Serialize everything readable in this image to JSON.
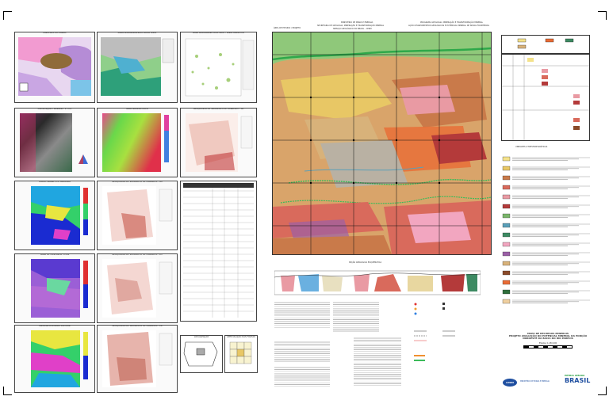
{
  "header": {
    "org_line1": "MINISTÉRIO DE MINAS E ENERGIA",
    "org_line2": "SECRETARIA DE GEOLOGIA, MINERAÇÃO E TRANSFORMAÇÃO MINERAL",
    "org_line3": "SERVIÇO GEOLÓGICO DO BRASIL - CPRM",
    "right_line1": "PROGRAMA GEOLOGIA, MINERAÇÃO E TRANSFORMAÇÃO MINERAL",
    "right_line2": "AÇÃO LEVANTAMENTOS GEOLÓGICOS E POTENCIAL MINERAL DE NOVAS FRONTEIRAS",
    "left_title": "ÁREA DE ESTUDO / PROJETO"
  },
  "panels": {
    "geo_context": "MAPA GEOTECTÔNICO",
    "geophysics": "MAPA AEROGAMAESPECTROMÉTRICO",
    "aeromag": "MAPA AEROMAGNETOMÉTRICO - SINAL ANALÍTICO",
    "ternary": "COMPOSIÇÃO TERNÁRIA - K Th U",
    "gravity": "MAPA GRAVIMÉTRICO",
    "anomaly_mag": "CAMPO MAGNÉTICO ANÔMALO",
    "residual": "MAPA DE CONTAGEM TOTAL",
    "tilt": "PRIMEIRA DERIVADA VERTICAL",
    "geochem_cu": "GEOQUÍMICA DE SEDIMENTO DE CORRENTE - Cu",
    "geochem_au": "GEOQUÍMICA DE SEDIMENTO DE CORRENTE - Au",
    "geochem_zn": "GEOQUÍMICA DE SEDIMENTO DE CORRENTE - Zn",
    "geochem_pb": "GEOQUÍMICA DE SEDIMENTO DE CORRENTE - Pb",
    "geochem_ni": "GEOQUÍMICA DE SEDIMENTO DE CORRENTE - Ni",
    "occurrences": "MAPA DE OCORRÊNCIAS MINERAIS",
    "location": "LOCALIZAÇÃO",
    "articulation": "ARTICULAÇÃO DAS FOLHAS"
  },
  "main_map": {
    "section_title": "SEÇÃO GEOLÓGICA ESQUEMÁTICA",
    "legend_title": "UNIDADES LITOESTRATIGRÁFICAS",
    "coord_labels": [
      "58°00'",
      "57°30'",
      "57°00'",
      "56°30'",
      "56°00'",
      "55°30'"
    ]
  },
  "legend": {
    "units": [
      {
        "color": "#f4e28a"
      },
      {
        "color": "#e8c765"
      },
      {
        "color": "#c97a4a"
      },
      {
        "color": "#d96a5c"
      },
      {
        "color": "#e99aa3"
      },
      {
        "color": "#b43a3a"
      },
      {
        "color": "#7ab56a"
      },
      {
        "color": "#5a9fb8"
      },
      {
        "color": "#3d8a62"
      },
      {
        "color": "#f2a6c0"
      },
      {
        "color": "#9b5fa6"
      },
      {
        "color": "#d8b27a"
      },
      {
        "color": "#8a4b2a"
      },
      {
        "color": "#e96b35"
      },
      {
        "color": "#2f6e3c"
      },
      {
        "color": "#f0d0a0"
      }
    ]
  },
  "footer": {
    "map_title_1": "MAPA DE RECURSOS MINERAIS",
    "map_title_2": "PROJETO AVALIAÇÃO DO POTENCIAL MINERAL DA PORÇÃO",
    "map_title_3": "NOROESTE DA BACIA DO RIO PARECIS",
    "scale": "ESCALA 1:250.000",
    "logo_cprm": "CPRM",
    "logo_brasil": "BRASIL",
    "logo_patria": "PÁTRIA AMADA",
    "ministry": "MINISTÉRIO DE MINAS E ENERGIA"
  },
  "colors": {
    "rainbow": [
      "#1a2bd1",
      "#20a6e0",
      "#34d06a",
      "#e8e640",
      "#f09030",
      "#e03030",
      "#e040c8"
    ],
    "map_base": "#d9a46a",
    "river": "#2ea84a"
  }
}
